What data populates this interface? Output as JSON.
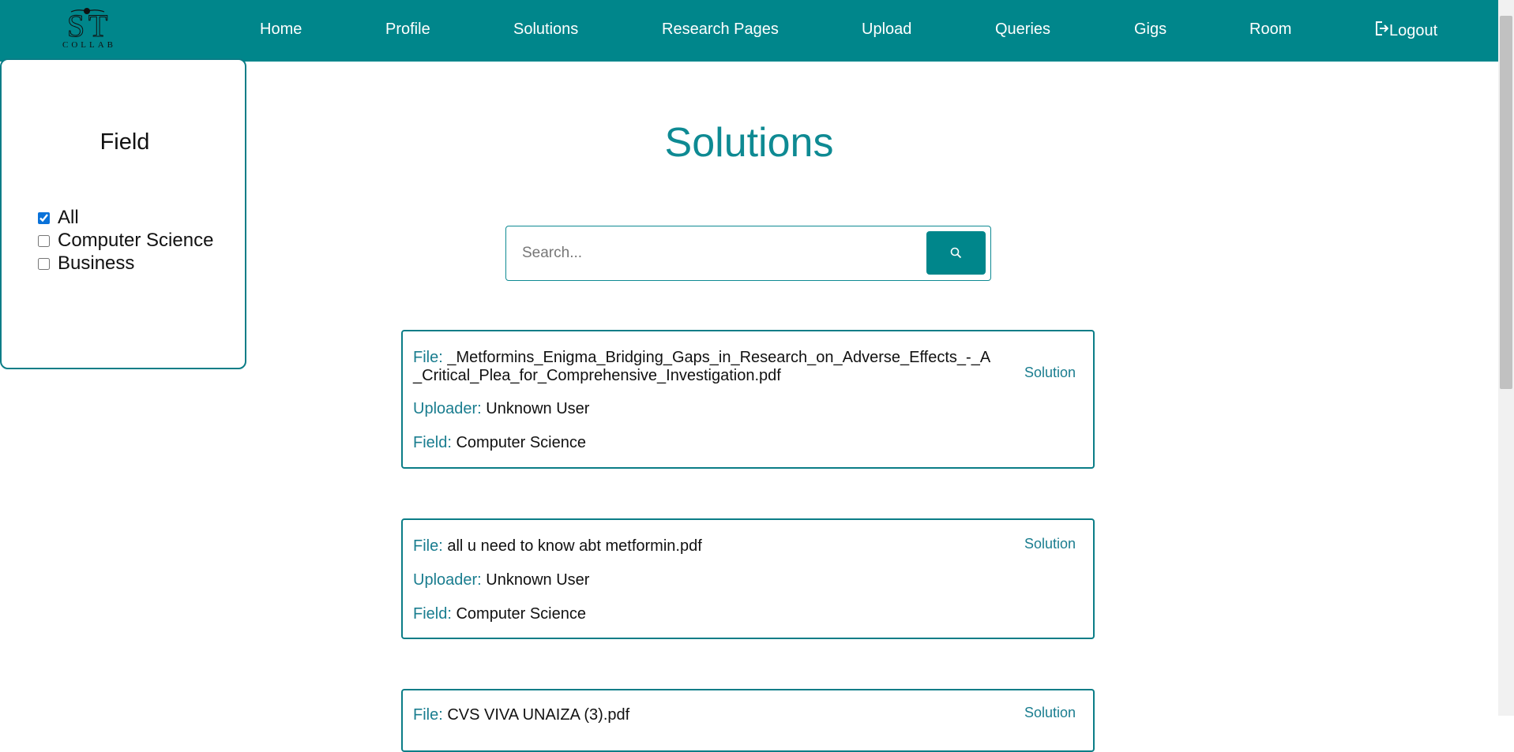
{
  "app": {
    "logo_text": "COLLAB"
  },
  "nav": {
    "items": [
      {
        "label": "Home"
      },
      {
        "label": "Profile"
      },
      {
        "label": "Solutions"
      },
      {
        "label": "Research Pages"
      },
      {
        "label": "Upload"
      },
      {
        "label": "Queries"
      },
      {
        "label": "Gigs"
      },
      {
        "label": "Room"
      }
    ],
    "logout_label": "Logout"
  },
  "sidebar": {
    "title": "Field",
    "filters": [
      {
        "label": "All",
        "checked": true
      },
      {
        "label": "Computer Science",
        "checked": false
      },
      {
        "label": "Business",
        "checked": false
      }
    ]
  },
  "main": {
    "title": "Solutions",
    "search": {
      "placeholder": "Search...",
      "value": "",
      "icon": "search-icon"
    },
    "labels": {
      "file": "File:",
      "uploader": "Uploader:",
      "field": "Field:",
      "solution_link": "Solution"
    },
    "cards": [
      {
        "file": "_Metformins_Enigma_Bridging_Gaps_in_Research_on_Adverse_Effects_-_A_Critical_Plea_for_Comprehensive_Investigation.pdf",
        "uploader": "Unknown User",
        "field": "Computer Science"
      },
      {
        "file": "all u need to know abt metformin.pdf",
        "uploader": "Unknown User",
        "field": "Computer Science"
      },
      {
        "file": "CVS VIVA UNAIZA (3).pdf",
        "uploader": "",
        "field": ""
      }
    ]
  },
  "colors": {
    "accent": "#00868b",
    "label_text": "#1a7d8f",
    "checkbox": "#0a72d9"
  }
}
